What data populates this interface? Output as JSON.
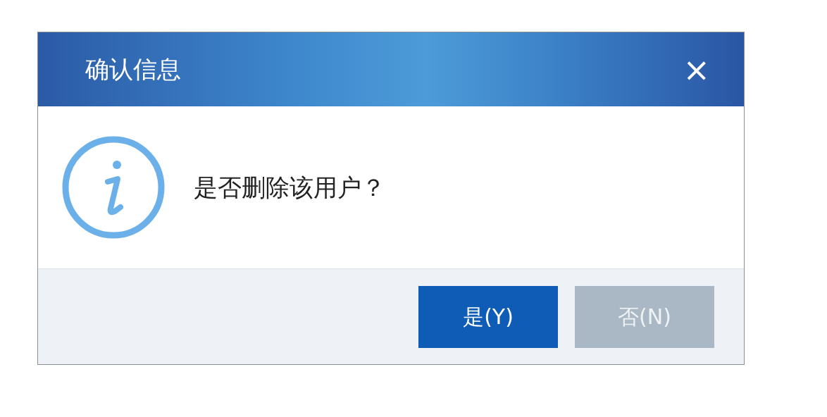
{
  "dialog": {
    "title": "确认信息",
    "close": "×",
    "message": "是否删除该用户？",
    "buttons": [
      {
        "label": "是(Y)",
        "disabled": false
      },
      {
        "label": "否(N)",
        "disabled": true
      }
    ]
  }
}
